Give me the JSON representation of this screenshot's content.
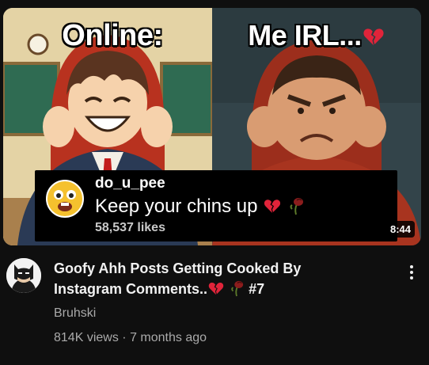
{
  "video": {
    "thumbnail": {
      "left_caption": "Online:",
      "right_caption": "Me IRL...",
      "comment": {
        "username": "do_u_pee",
        "text": "Keep your chins up",
        "likes": "58,537 likes"
      },
      "duration": "8:44"
    },
    "title_line1": "Goofy Ahh Posts Getting Cooked By",
    "title_line2_text": "Instagram Comments..",
    "title_line2_suffix": "#7",
    "channel": "Bruhski",
    "views": "814K views",
    "separator": "·",
    "age": "7 months ago"
  },
  "icons": {
    "broken_heart": "broken-heart-icon",
    "wilted_rose": "wilted-rose-icon",
    "more": "more-vert-icon",
    "avatar_emoji": "surprised-face-icon"
  },
  "colors": {
    "background": "#0f0f0f",
    "text_primary": "#f1f1f1",
    "text_secondary": "#aaaaaa",
    "broken_heart": "#e0243a",
    "rose": "#8c1d1d"
  }
}
